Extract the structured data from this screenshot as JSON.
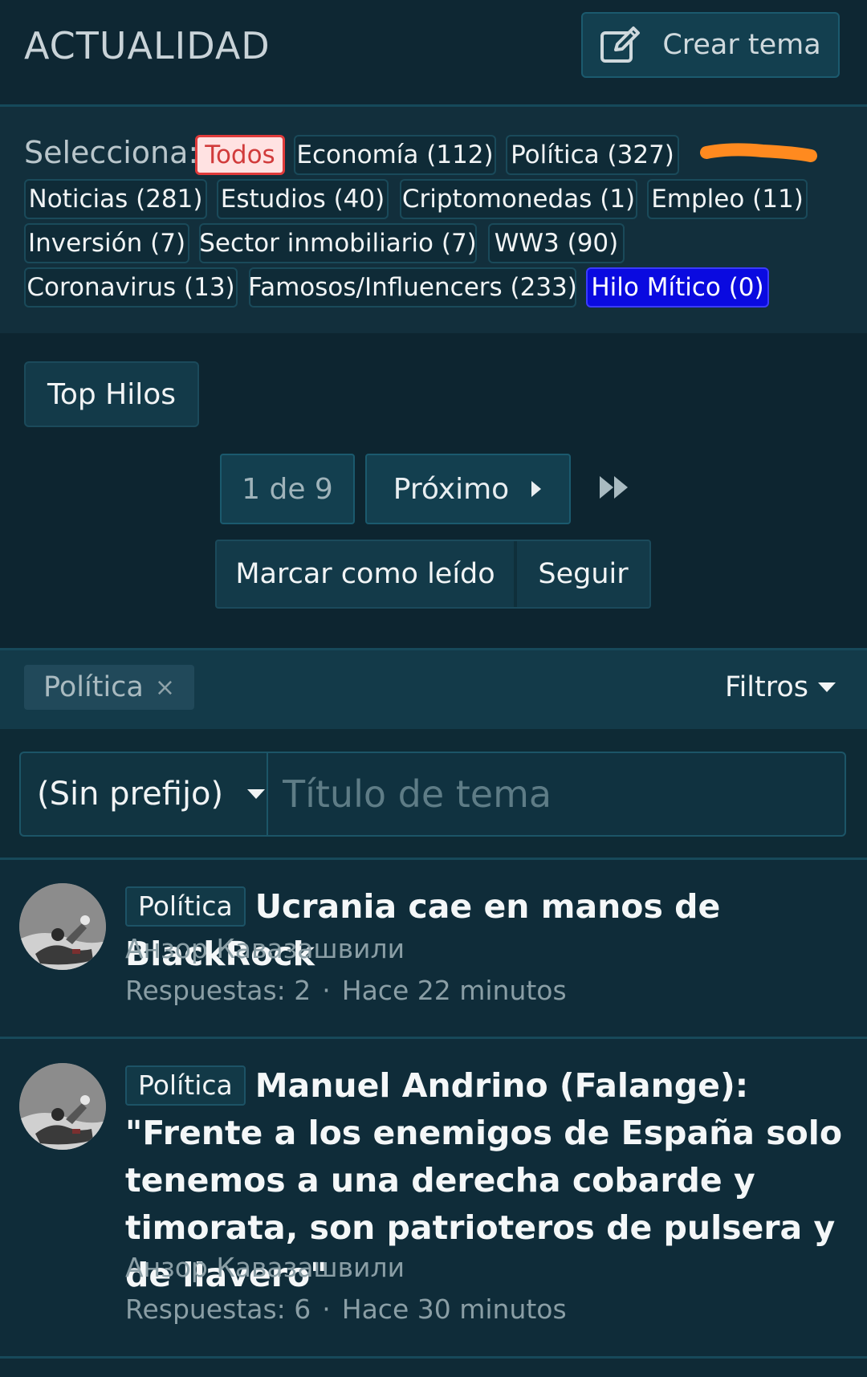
{
  "header": {
    "title": "ACTUALIDAD",
    "create_label": "Crear tema",
    "create_icon": "edit-icon"
  },
  "categories": {
    "label": "Selecciona:",
    "items": [
      {
        "label": "Todos",
        "state": "selected",
        "color": "#e03b3b"
      },
      {
        "label": "Economía (112)"
      },
      {
        "label": "Política (327)"
      },
      {
        "label": "Noticias (281)"
      },
      {
        "label": "Estudios (40)"
      },
      {
        "label": "Criptomonedas (1)"
      },
      {
        "label": "Empleo (11)"
      },
      {
        "label": "Inversión (7)"
      },
      {
        "label": "Sector inmobiliario (7)"
      },
      {
        "label": "WW3 (90)"
      },
      {
        "label": "Coronavirus (13)"
      },
      {
        "label": "Famosos/Influencers (233)"
      },
      {
        "label": "Hilo Mítico (0)",
        "color": "#0a0ae0"
      }
    ]
  },
  "top_hilos_label": "Top Hilos",
  "pagination": {
    "current": "1 de 9",
    "next_label": "Próximo"
  },
  "actions": {
    "mark_read": "Marcar como leído",
    "follow": "Seguir"
  },
  "filter_bar": {
    "active_tag": "Política",
    "remove_symbol": "×",
    "filters_label": "Filtros"
  },
  "new_thread": {
    "prefix_value": "(Sin prefijo)",
    "title_placeholder": "Título de tema"
  },
  "threads": [
    {
      "prefix": "Política",
      "title": "Ucrania cae en manos de BlackRock",
      "author": "Анзор Кавазашвили",
      "replies": "Respuestas: 2",
      "separator": "·",
      "time": "Hace 22 minutos"
    },
    {
      "prefix": "Política",
      "title": "Manuel Andrino (Falange): \"Frente a los enemigos de España solo tenemos a una derecha cobarde y timorata, son patrioteros de pulsera y de llavero\"",
      "author": "Анзор Кавазашвили",
      "replies": "Respuestas: 6",
      "separator": "·",
      "time": "Hace 30 minutos"
    }
  ]
}
